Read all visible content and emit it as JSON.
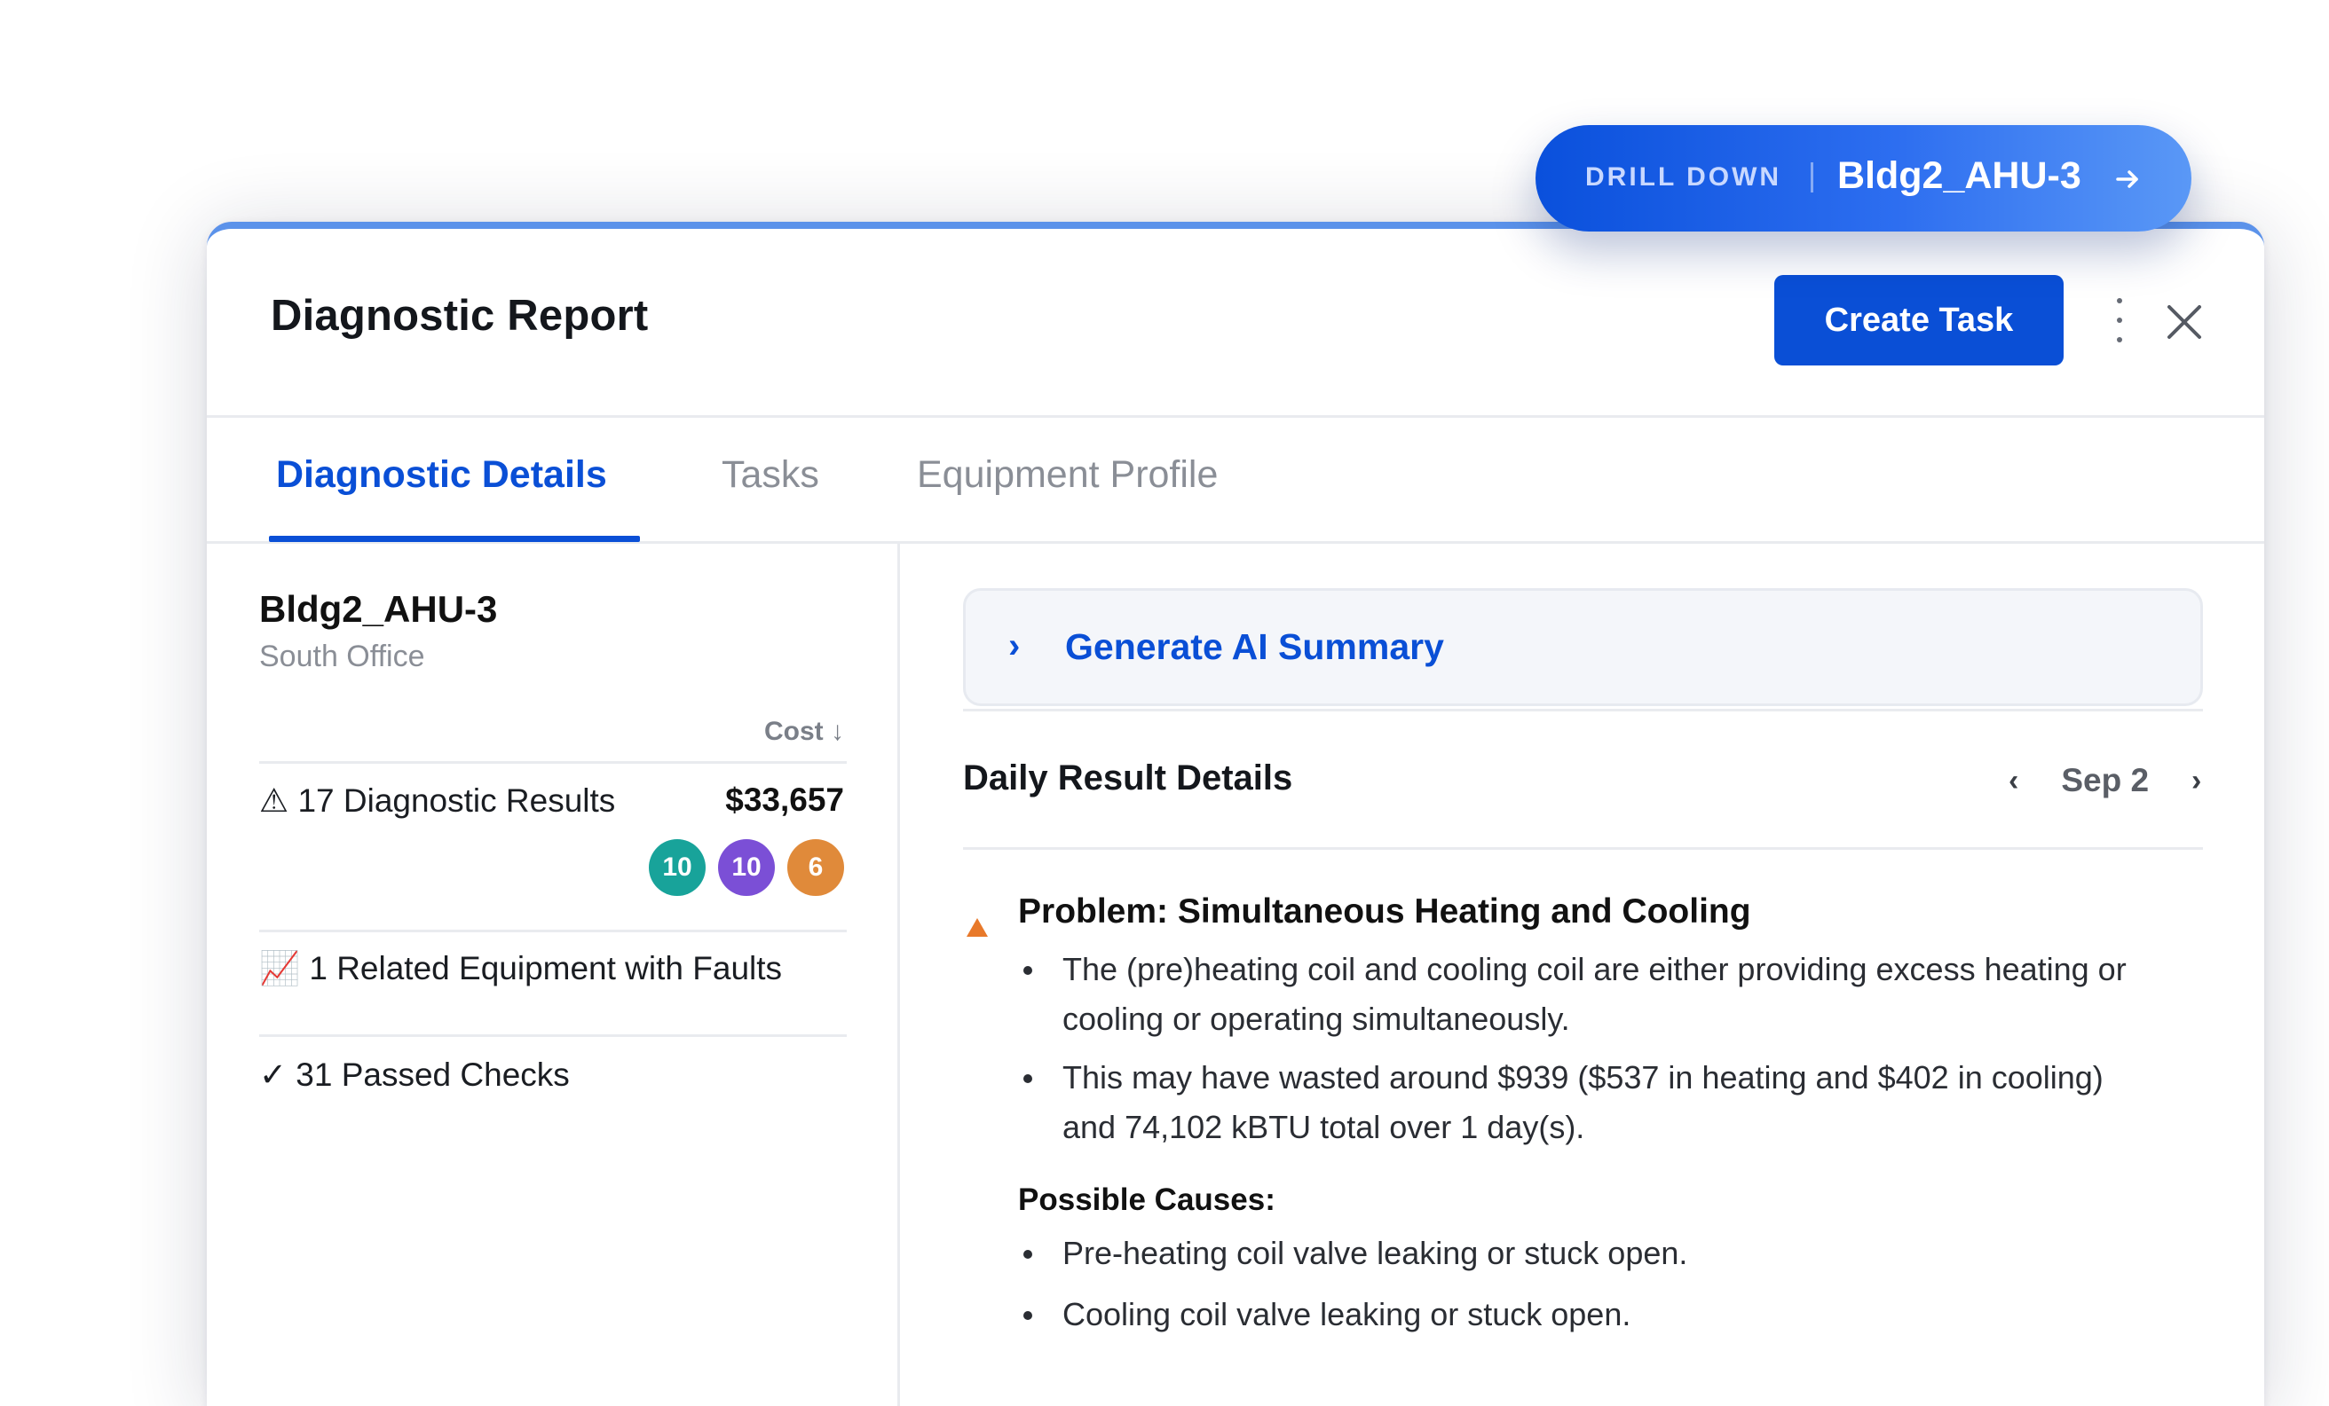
{
  "drill_down": {
    "label": "DRILL DOWN",
    "equipment": "Bldg2_AHU-3"
  },
  "header": {
    "title": "Diagnostic Report",
    "create_task_label": "Create Task"
  },
  "tabs": [
    {
      "label": "Diagnostic Details",
      "active": true
    },
    {
      "label": "Tasks",
      "active": false
    },
    {
      "label": "Equipment Profile",
      "active": false
    }
  ],
  "equipment": {
    "name": "Bldg2_AHU-3",
    "location": "South Office"
  },
  "summary": {
    "cost_sort_label": "Cost ↓",
    "diagnostic_results": "⚠ 17 Diagnostic Results",
    "cost_total": "$33,657",
    "badges": [
      {
        "value": "10",
        "color": "#18a39a"
      },
      {
        "value": "10",
        "color": "#7b4fd6"
      },
      {
        "value": "6",
        "color": "#e08a3a"
      }
    ],
    "related_equipment": "📈 1 Related Equipment with Faults",
    "passed_checks": "✓ 31 Passed Checks"
  },
  "ai_summary": {
    "chevron": "›",
    "label": "Generate AI Summary"
  },
  "daily": {
    "title": "Daily Result Details",
    "prev": "‹",
    "date": "Sep 2",
    "next": "›"
  },
  "problem": {
    "title": "Problem: Simultaneous Heating and Cooling",
    "details": [
      "The (pre)heating coil and cooling coil are either providing excess heating or cooling or operating simultaneously.",
      "This may have wasted around $939 ($537 in heating and $402 in cooling) and 74,102 kBTU total over 1 day(s)."
    ],
    "causes_title": "Possible Causes:",
    "causes": [
      "Pre-heating coil valve leaking or stuck open.",
      "Cooling coil valve leaking or stuck open."
    ]
  },
  "colors": {
    "accent": "#0a4fd6",
    "warning": "#e8792a"
  }
}
